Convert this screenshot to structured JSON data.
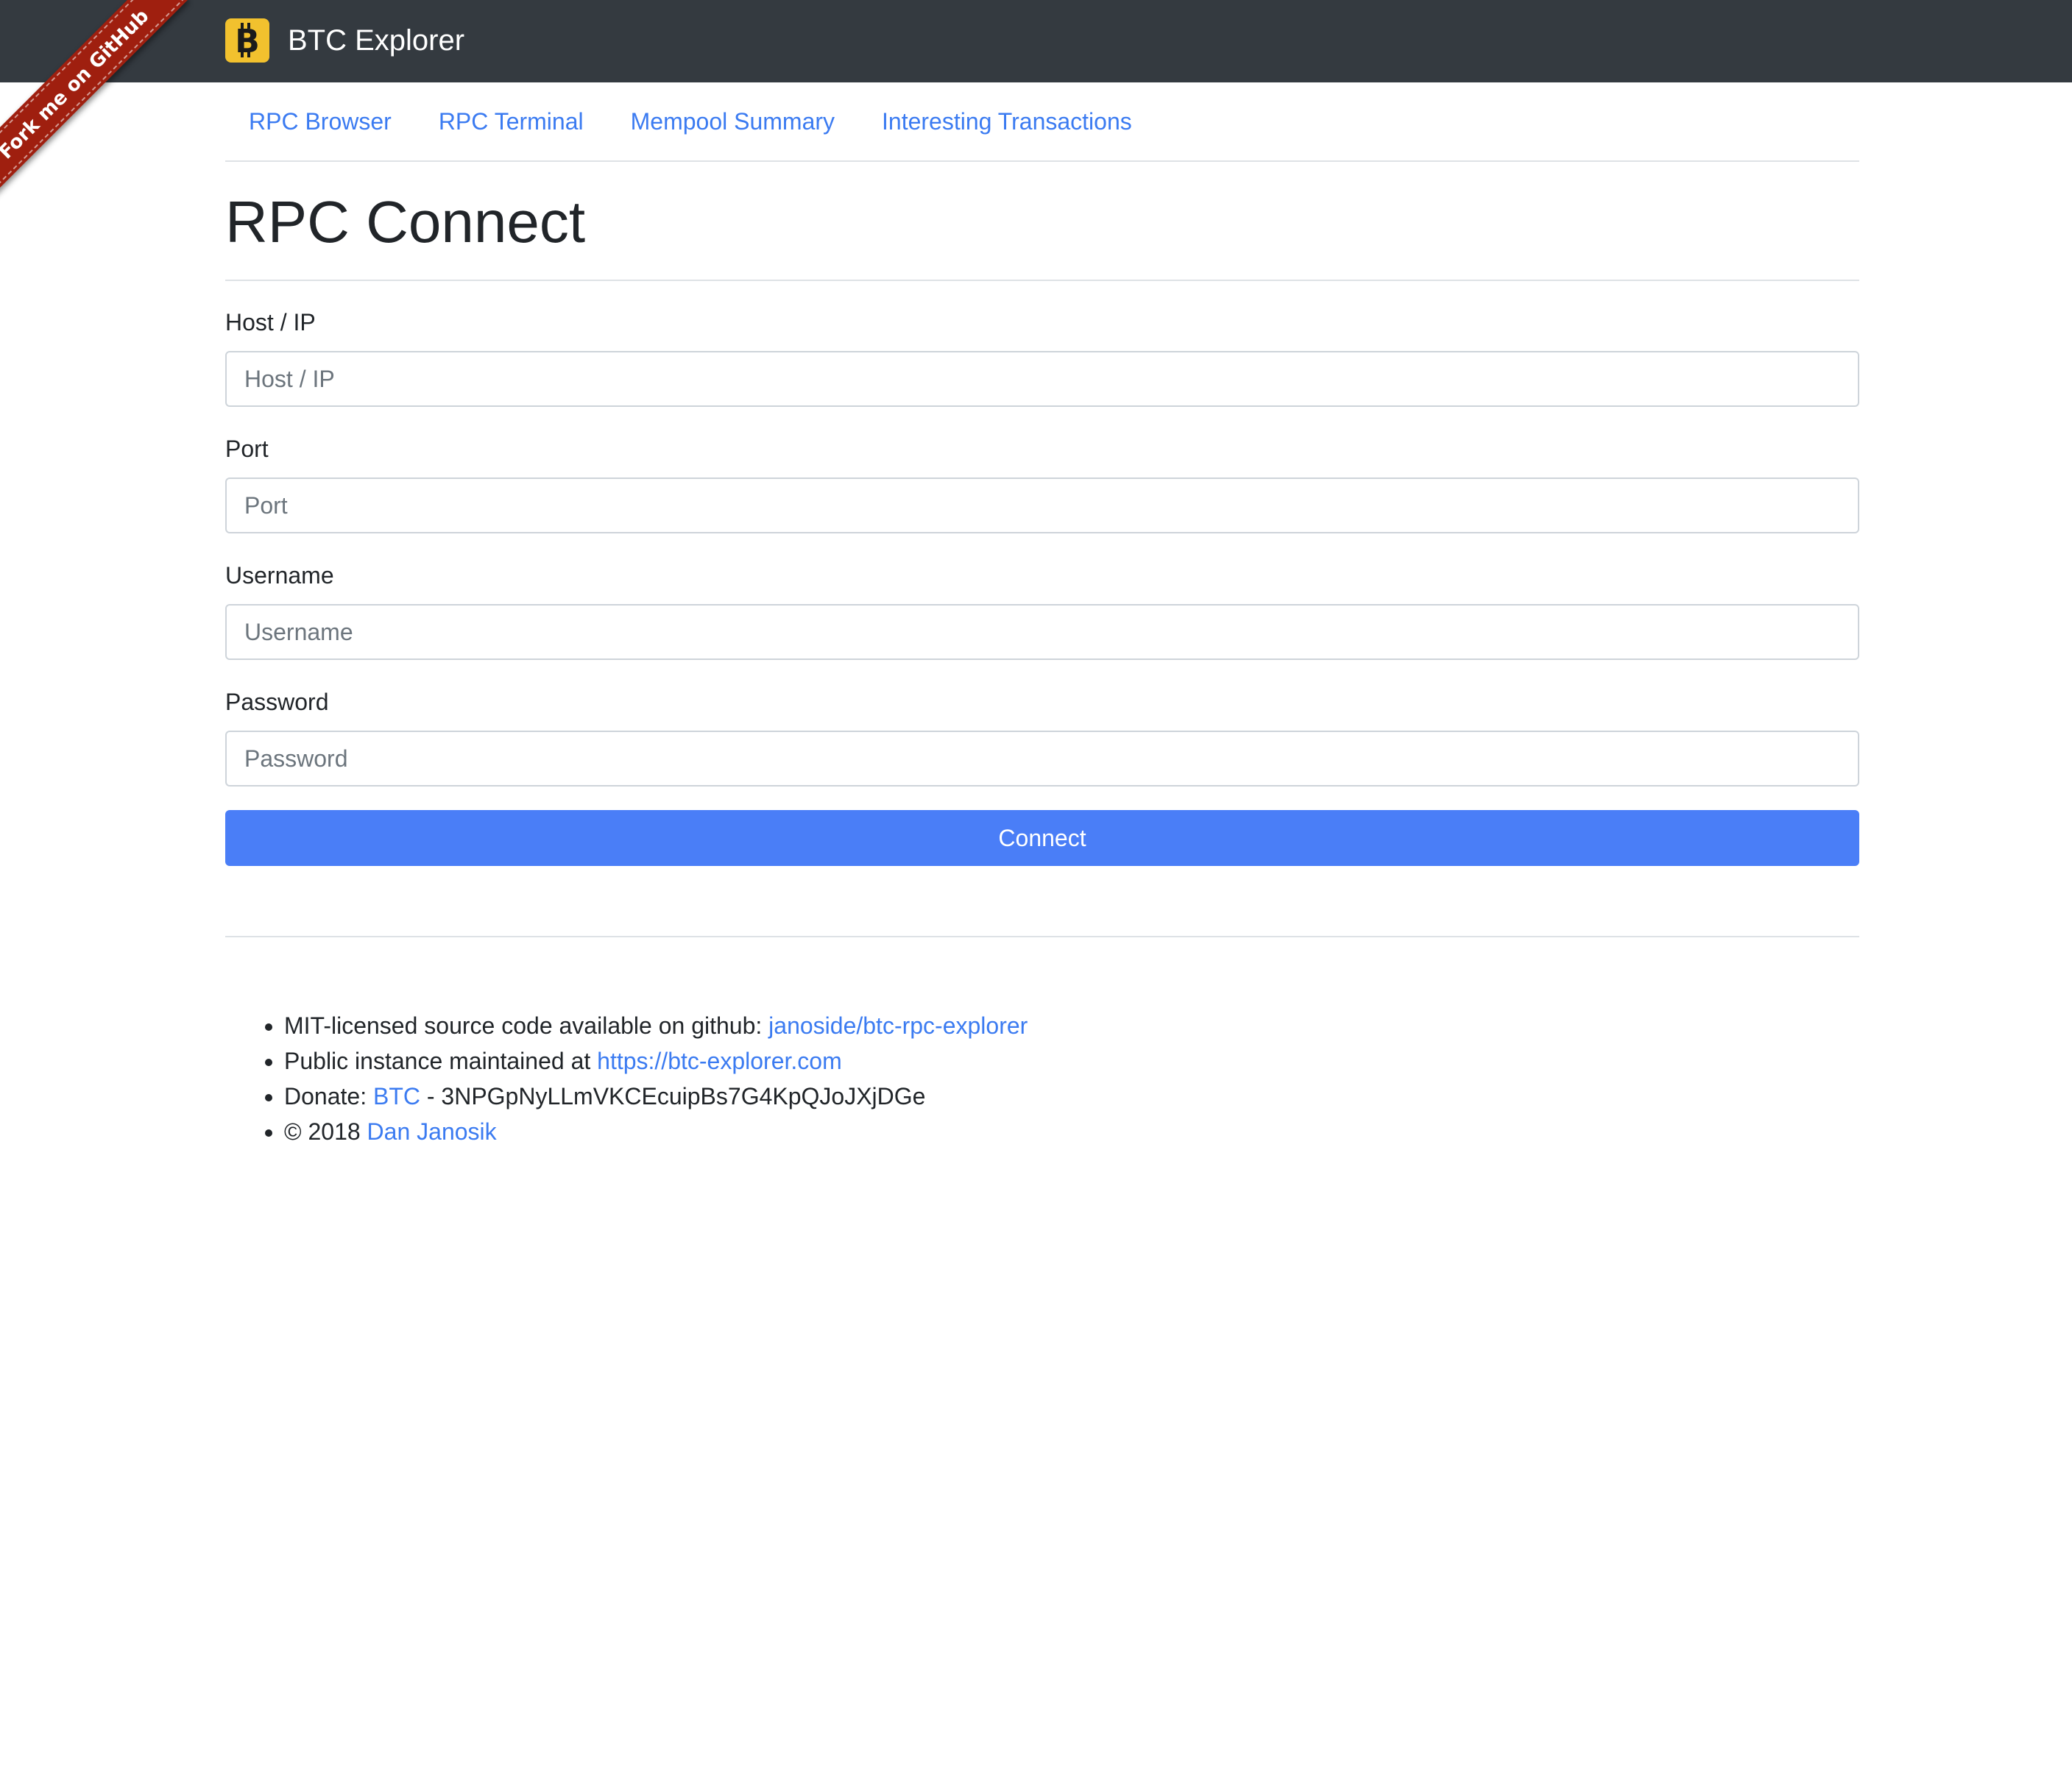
{
  "header": {
    "brand_title": "BTC Explorer",
    "brand_icon": "bitcoin-icon",
    "bar_color": "#343a40",
    "logo_color": "#f2c12e"
  },
  "ribbon": {
    "text": "Fork me on GitHub",
    "color": "#9f1f0f"
  },
  "nav": {
    "items": [
      {
        "label": "RPC Browser"
      },
      {
        "label": "RPC Terminal"
      },
      {
        "label": "Mempool Summary"
      },
      {
        "label": "Interesting Transactions"
      }
    ],
    "link_color": "#3b7bf1"
  },
  "page": {
    "title": "RPC Connect"
  },
  "form": {
    "host": {
      "label": "Host / IP",
      "placeholder": "Host / IP",
      "value": ""
    },
    "port": {
      "label": "Port",
      "placeholder": "Port",
      "value": ""
    },
    "username": {
      "label": "Username",
      "placeholder": "Username",
      "value": ""
    },
    "password": {
      "label": "Password",
      "placeholder": "Password",
      "value": ""
    },
    "submit_label": "Connect",
    "button_color": "#4a7ef7"
  },
  "footer": {
    "source": {
      "text": "MIT-licensed source code available on github: ",
      "link": "janoside/btc-rpc-explorer"
    },
    "instance": {
      "text": "Public instance maintained at ",
      "link": "https://btc-explorer.com"
    },
    "donate": {
      "text": "Donate: ",
      "link": "BTC",
      "suffix": " - 3NPGpNyLLmVKCEcuipBs7G4KpQJoJXjDGe"
    },
    "copyright": {
      "text": "© 2018 ",
      "link": "Dan Janosik"
    }
  }
}
